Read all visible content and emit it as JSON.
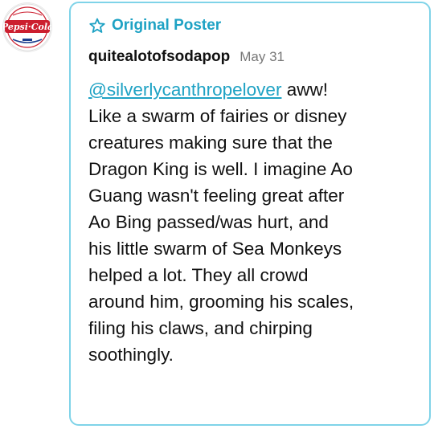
{
  "avatar": {
    "icon": "pepsi-cola-logo",
    "logo_text": "Pepsi-Cola",
    "colors": {
      "red": "#cc1f2f",
      "blue": "#1d3f8f"
    }
  },
  "card": {
    "border_color": "#7fd3e8",
    "badge": {
      "icon": "star-outline-icon",
      "label": "Original Poster",
      "color": "#1ea2c4"
    },
    "username": "quitealotofsodapop",
    "date": "May 31",
    "mention": "@silverlycanthropelover",
    "body_lines": [
      " aww!",
      "Like a swarm of fairies or disney",
      "creatures making sure that the",
      "Dragon King is well. I imagine Ao",
      "Guang wasn't feeling great after",
      "Ao Bing passed/was hurt, and",
      "his little swarm of Sea Monkeys",
      "helped a lot. They all crowd",
      "around him, grooming his scales,",
      "filing his claws, and chirping",
      "soothingly."
    ]
  }
}
